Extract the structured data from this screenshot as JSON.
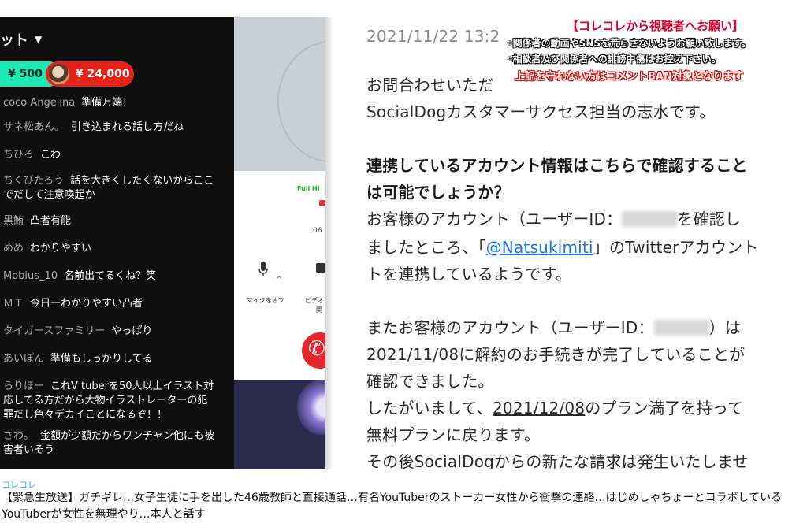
{
  "chat": {
    "header_label": "ット",
    "superchats": [
      {
        "amount": "¥ 500",
        "color": "#1de9b6"
      },
      {
        "amount": "¥ 24,000",
        "color": "#e62117"
      }
    ],
    "messages": [
      {
        "author": "coco Angelina",
        "text": "準備万端！"
      },
      {
        "author": "サネ松あん。",
        "text": "引き込まれる話し方だね"
      },
      {
        "author": "ちひろ",
        "text": "こわ"
      },
      {
        "author": "ちくびたろう",
        "text": "話を大きくしたくないからここ",
        "text2": "でだして注意喚起か"
      },
      {
        "author": "黒鮪",
        "text": "凸者有能"
      },
      {
        "author": "めめ",
        "text": "わかりやすい"
      },
      {
        "author": "Mobius_10",
        "text": "名前出てるくね？笑"
      },
      {
        "author": "ＭＴ",
        "text": "今日一わかりやすい凸者"
      },
      {
        "author": "タイガースファミリー",
        "text": "やっぱり"
      },
      {
        "author": "あいぽん",
        "text": "準備もしっかりしてる"
      },
      {
        "author": "らりほー",
        "text": "これV tuberを50人以上イラスト対",
        "text2": "応してる方だから大物イラストレーターの犯",
        "text3": "罪だし色々デカイことになるぞ！！"
      },
      {
        "author": "さわ。",
        "text": "金額が少額だからワンチャン他にも被",
        "text2": "害者いそう"
      }
    ]
  },
  "call": {
    "fullhd": "Full HI",
    "time": "06",
    "mic_label": "マイクをオフ",
    "video_label": "ビデオ",
    "video_label2": "関"
  },
  "email": {
    "date": "2021/11/22 13:2",
    "l1": "お問合わせいただ",
    "l2": "SocialDogカスタマーサクセス担当の志水です。",
    "h1": "連携しているアカウント情報はこちらで確認すること",
    "h2": "は可能でしょうか？",
    "p1a": "お客様のアカウント（ユーザーID：",
    "p1b": "を確認し",
    "p2a": "ましたところ、「",
    "p2link": "@Natsukimiti",
    "p2b": "」のTwitterアカウント",
    "p3": "トを連携しているようです。",
    "p4a": "またお客様のアカウント（ユーザーID：",
    "p4b": "）は",
    "p5": "2021/11/08に解約のお手続きが完了していることが",
    "p6": "確認できました。",
    "p7a": "したがいまして、",
    "p7date": "2021/12/08",
    "p7b": "のプラン満了を持って",
    "p8": "無料プランに戻ります。",
    "p9": "その後SocialDogからの新たな請求は発生いたしませ"
  },
  "notice": {
    "title": "【コレコレから視聴者へお願い】",
    "line1": "◦関係者の動画やSNSを荒らさないようお願い致します。",
    "line2": "◦相談者及び関係者への誹謗中傷はお控え下さい。",
    "line3": "上記を守れない方はコメントBAN対象となります"
  },
  "video_info": {
    "channel": "コレコレ",
    "title": "【緊急生放送】ガチギレ…女子生徒に手を出した46歳教師と直接通話…有名YouTuberのストーカー女性から衝撃の連絡…はじめしゃちょーとコラボしているYouTuberが女性を無理やり…本人と話す"
  }
}
